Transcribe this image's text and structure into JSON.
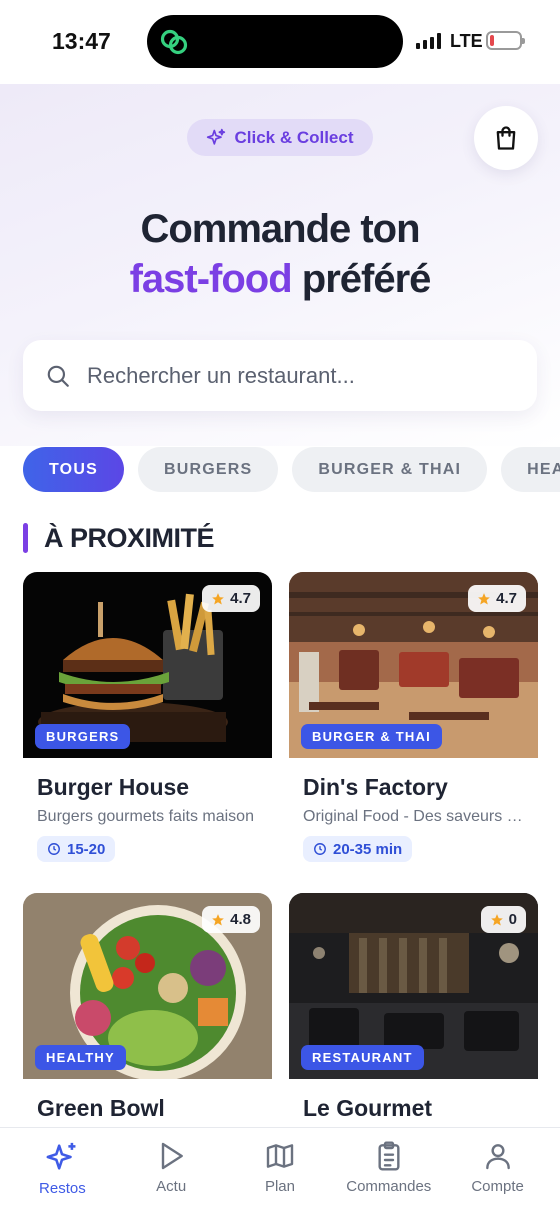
{
  "status_bar": {
    "time": "13:47",
    "network": "LTE"
  },
  "hero": {
    "badge": "Click & Collect",
    "title_line1": "Commande ton",
    "title_accent": "fast-food",
    "title_rest": "préféré",
    "search_placeholder": "Rechercher un restaurant..."
  },
  "categories": [
    {
      "label": "TOUS",
      "active": true
    },
    {
      "label": "BURGERS",
      "active": false
    },
    {
      "label": "BURGER & THAI",
      "active": false
    },
    {
      "label": "HEALTHY",
      "active": false
    }
  ],
  "section": {
    "title": "À PROXIMITÉ"
  },
  "restaurants": [
    {
      "name": "Burger House",
      "category": "BURGERS",
      "rating": "4.7",
      "description": "Burgers gourmets faits maison",
      "time": "15-20"
    },
    {
      "name": "Din's Factory",
      "category": "BURGER & THAI",
      "rating": "4.7",
      "description": "Original Food - Des saveurs uniques",
      "time": "20-35 min"
    },
    {
      "name": "Green Bowl",
      "category": "HEALTHY",
      "rating": "4.8"
    },
    {
      "name": "Le Gourmet",
      "category": "RESTAURANT",
      "rating": "0"
    }
  ],
  "bottom_nav": [
    {
      "label": "Restos",
      "icon": "sparkles-icon",
      "active": true
    },
    {
      "label": "Actu",
      "icon": "play-icon",
      "active": false
    },
    {
      "label": "Plan",
      "icon": "map-icon",
      "active": false
    },
    {
      "label": "Commandes",
      "icon": "clipboard-icon",
      "active": false
    },
    {
      "label": "Compte",
      "icon": "user-icon",
      "active": false
    }
  ],
  "colors": {
    "accent": "#7b3fe4",
    "primary": "#3f5be6",
    "text": "#1f2433"
  }
}
